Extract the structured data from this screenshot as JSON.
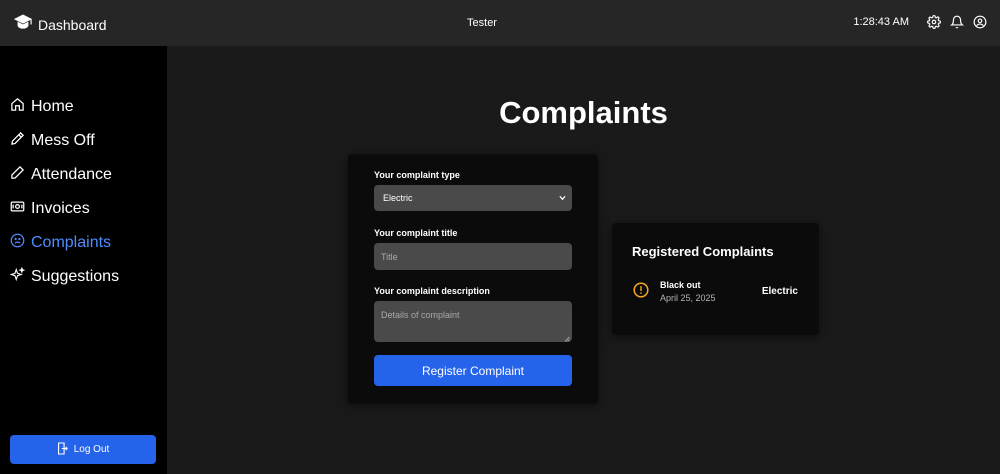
{
  "header": {
    "brand": "Dashboard",
    "user": "Tester",
    "time": "1:28:43 AM",
    "icons": [
      "graduation-cap-icon",
      "gear-icon",
      "bell-icon",
      "user-circle-icon"
    ]
  },
  "sidebar": {
    "items": [
      {
        "label": "Home",
        "icon": "home-icon",
        "active": false
      },
      {
        "label": "Mess Off",
        "icon": "pen-icon",
        "active": false
      },
      {
        "label": "Attendance",
        "icon": "pencil-icon",
        "active": false
      },
      {
        "label": "Invoices",
        "icon": "cash-icon",
        "active": false
      },
      {
        "label": "Complaints",
        "icon": "sad-face-icon",
        "active": true
      },
      {
        "label": "Suggestions",
        "icon": "sparkles-icon",
        "active": false
      }
    ],
    "logout_label": "Log Out"
  },
  "main": {
    "title": "Complaints",
    "form": {
      "type_label": "Your complaint type",
      "type_value": "Electric",
      "title_label": "Your complaint title",
      "title_placeholder": "Title",
      "description_label": "Your complaint description",
      "description_placeholder": "Details of complaint",
      "submit_label": "Register Complaint"
    },
    "registered": {
      "heading": "Registered Complaints",
      "items": [
        {
          "title": "Black out",
          "date": "April 25, 2025",
          "type": "Electric",
          "status_icon": "exclamation-circle-icon"
        }
      ]
    }
  },
  "colors": {
    "accent": "#2563eb",
    "active_nav": "#4f8cff",
    "warning": "#f5a623",
    "background": "#1a1a1a",
    "topbar": "#262626",
    "sidebar": "#000000",
    "card": "#0b0b0b",
    "field": "#4a4a4a"
  }
}
